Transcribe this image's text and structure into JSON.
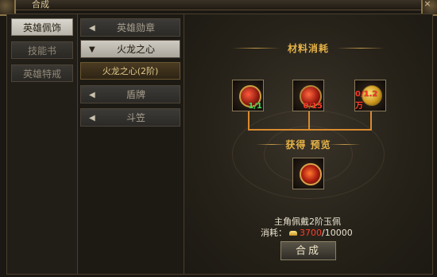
{
  "window": {
    "title": "合成",
    "close_label": "×"
  },
  "categories": [
    {
      "label": "英雄佩饰",
      "active": true
    },
    {
      "label": "技能书",
      "active": false
    },
    {
      "label": "英雄特戒",
      "active": false
    }
  ],
  "tree": {
    "items": [
      {
        "label": "英雄勋章",
        "open": false,
        "arrow": "◀"
      },
      {
        "label": "火龙之心",
        "open": true,
        "arrow": "▼"
      },
      {
        "label": "盾牌",
        "open": false,
        "arrow": "◀"
      },
      {
        "label": "斗笠",
        "open": false,
        "arrow": "◀"
      }
    ],
    "sub_item": "火龙之心(2阶)"
  },
  "materials": {
    "title": "材料消耗",
    "slots": [
      {
        "icon": "red-dragon-pendant-icon",
        "count": "1/1",
        "enough": true
      },
      {
        "icon": "red-orb-icon",
        "count": "0/15",
        "enough": false
      },
      {
        "icon": "gold-coin-icon",
        "count": "0/1.2万",
        "enough": false
      }
    ]
  },
  "preview": {
    "title": "获得 预览",
    "icon": "fire-dragon-heart-icon",
    "description": "主角佩戴2阶玉佩",
    "cost_label": "消耗：",
    "cost_current": "3700",
    "cost_total": "/10000"
  },
  "synth_button": "合成",
  "colors": {
    "accent": "#e6b347",
    "insufficient": "#ff3b2b",
    "sufficient": "#46e05a",
    "connector": "#d98a2f"
  }
}
